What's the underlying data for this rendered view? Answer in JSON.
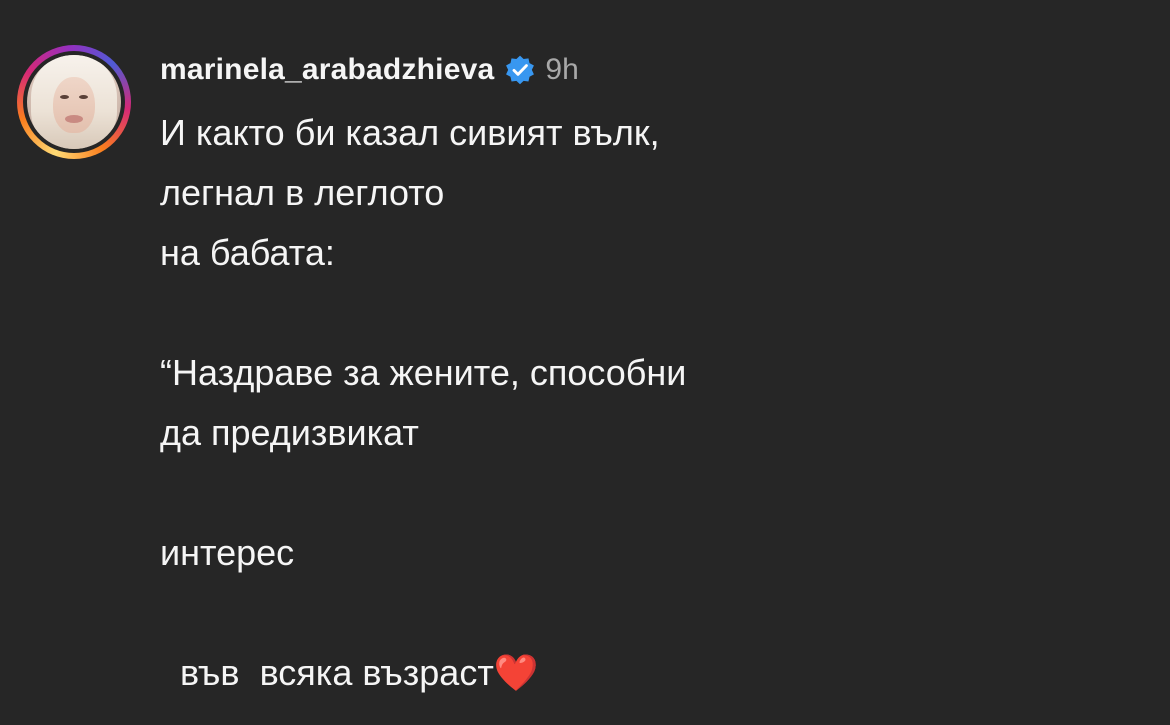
{
  "comment": {
    "username": "marinela_arabadzhieva",
    "time": "9h",
    "lines": [
      "И както би казал сивият вълк,",
      "легнал в леглото",
      "на бабата:",
      "",
      "“Наздраве за жените, способни",
      "да предизвикат",
      "",
      "интерес",
      "",
      "  във  всяка възраст"
    ],
    "heart_emoji": "❤️"
  },
  "colors": {
    "background": "#262626",
    "text": "#f5f5f5",
    "muted": "#a8a8a8",
    "verified": "#3897f0"
  },
  "icons": {
    "verified": "verified-badge-icon",
    "avatar": "profile-photo"
  }
}
